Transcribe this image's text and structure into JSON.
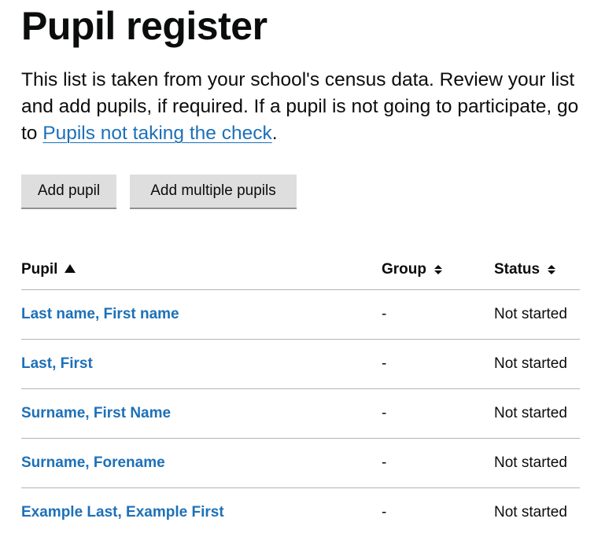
{
  "page": {
    "title": "Pupil register",
    "intro_text_1": "This list is taken from your school's census data. Review your list and add pupils, if required. If a pupil is not going to participate, go to ",
    "intro_link": "Pupils not taking the check",
    "intro_text_2": "."
  },
  "actions": {
    "add_pupil": "Add pupil",
    "add_multiple": "Add multiple pupils"
  },
  "table": {
    "headers": {
      "pupil": "Pupil",
      "group": "Group",
      "status": "Status"
    },
    "sort": {
      "pupil": "ascending",
      "group": "none",
      "status": "none"
    },
    "rows": [
      {
        "name": "Last name, First name",
        "group": "-",
        "status": "Not started"
      },
      {
        "name": "Last, First",
        "group": "-",
        "status": "Not started"
      },
      {
        "name": "Surname, First Name",
        "group": "-",
        "status": "Not started"
      },
      {
        "name": "Surname, Forename",
        "group": "-",
        "status": "Not started"
      },
      {
        "name": "Example Last, Example First",
        "group": "-",
        "status": "Not started"
      }
    ]
  },
  "colors": {
    "link": "#1d70b8",
    "text": "#0b0c0c",
    "button_bg": "#dedede",
    "divider": "#b1b4b6"
  }
}
